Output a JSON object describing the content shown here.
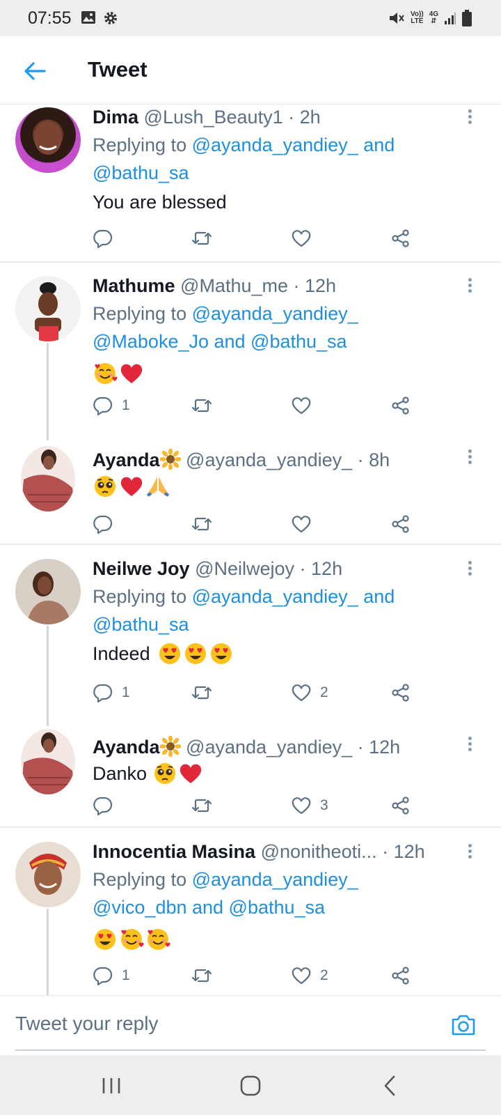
{
  "status_bar": {
    "time": "07:55",
    "network_top": "Vo))",
    "network_bottom": "LTE",
    "network_type": "4G"
  },
  "header": {
    "title": "Tweet"
  },
  "tweets": [
    {
      "name": "Dima",
      "handle": "@Lush_Beauty1",
      "time": "· 2h",
      "replying_prefix": "Replying to",
      "reply_line1": "@ayanda_yandiey_ and",
      "reply_line2": "@bathu_sa",
      "text": "You are blessed",
      "reply_count": "",
      "like_count": ""
    },
    {
      "name": "Mathume",
      "handle": "@Mathu_me",
      "time": "· 12h",
      "replying_prefix": "Replying to",
      "reply_line1": "@ayanda_yandiey_",
      "reply_line2": "@Maboke_Jo and @bathu_sa",
      "emojis": [
        "smiling-face-with-hearts",
        "red-heart"
      ],
      "reply_count": "1",
      "like_count": ""
    },
    {
      "name": "Ayanda",
      "name_emoji": "sunflower",
      "handle": "@ayanda_yandiey_",
      "time": "· 8h",
      "emojis": [
        "pleading-face",
        "red-heart",
        "folded-hands"
      ],
      "reply_count": "",
      "like_count": ""
    },
    {
      "name": "Neilwe Joy",
      "handle": "@Neilwejoy",
      "time": "· 12h",
      "replying_prefix": "Replying to",
      "reply_line1": "@ayanda_yandiey_ and",
      "reply_line2": "@bathu_sa",
      "text": "Indeed",
      "emojis": [
        "heart-eyes",
        "heart-eyes",
        "heart-eyes"
      ],
      "reply_count": "1",
      "like_count": "2"
    },
    {
      "name": "Ayanda",
      "name_emoji": "sunflower",
      "handle": "@ayanda_yandiey_",
      "time": "· 12h",
      "text": "Danko",
      "emojis": [
        "pleading-face",
        "red-heart"
      ],
      "reply_count": "",
      "like_count": "3"
    },
    {
      "name": "Innocentia Masina",
      "handle": "@nonitheoti...",
      "time": "· 12h",
      "replying_prefix": "Replying to",
      "reply_line1": "@ayanda_yandiey_",
      "reply_line2": "@vico_dbn and @bathu_sa",
      "emojis": [
        "heart-eyes",
        "smiling-face-with-hearts",
        "smiling-face-with-hearts"
      ],
      "reply_count": "1",
      "like_count": "2"
    }
  ],
  "reply_bar": {
    "placeholder": "Tweet your reply"
  },
  "colors": {
    "link": "#1d8fe1",
    "muted": "#5b7083",
    "text": "#141823",
    "divider": "#e6ecf0"
  }
}
